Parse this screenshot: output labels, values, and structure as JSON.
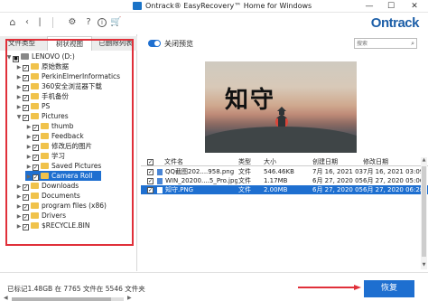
{
  "window": {
    "title": "Ontrack® EasyRecovery™ Home for Windows",
    "brand": "Ontrack",
    "minimize": "—",
    "maximize": "☐",
    "close": "✕"
  },
  "toolbar": {
    "icons": [
      "home-icon",
      "back-icon",
      "settings-icon",
      "help-icon",
      "info-icon",
      "cart-icon"
    ]
  },
  "left_tabs": [
    "文件类型",
    "树状视图",
    "已删除列表"
  ],
  "left_tabs_active": 1,
  "tree": [
    {
      "label": "LENOVO (D:)",
      "checked": "partial",
      "expanded": true,
      "depth": 0,
      "kind": "drive"
    },
    {
      "label": "原始数据",
      "checked": true,
      "expanded": false,
      "depth": 1,
      "kind": "folder"
    },
    {
      "label": "PerkinElmerInformatics",
      "checked": true,
      "expanded": false,
      "depth": 1,
      "kind": "folder"
    },
    {
      "label": "360安全浏览器下载",
      "checked": true,
      "expanded": false,
      "depth": 1,
      "kind": "folder"
    },
    {
      "label": "手机备份",
      "checked": true,
      "expanded": false,
      "depth": 1,
      "kind": "folder"
    },
    {
      "label": "PS",
      "checked": true,
      "expanded": false,
      "depth": 1,
      "kind": "folder"
    },
    {
      "label": "Pictures",
      "checked": true,
      "expanded": true,
      "depth": 1,
      "kind": "folder"
    },
    {
      "label": "thumb",
      "checked": true,
      "expanded": false,
      "depth": 2,
      "kind": "folder"
    },
    {
      "label": "Feedback",
      "checked": true,
      "expanded": false,
      "depth": 2,
      "kind": "folder"
    },
    {
      "label": "修改后的图片",
      "checked": true,
      "expanded": false,
      "depth": 2,
      "kind": "folder"
    },
    {
      "label": "学习",
      "checked": true,
      "expanded": false,
      "depth": 2,
      "kind": "folder"
    },
    {
      "label": "Saved Pictures",
      "checked": true,
      "expanded": false,
      "depth": 2,
      "kind": "folder"
    },
    {
      "label": "Camera Roll",
      "checked": true,
      "expanded": false,
      "depth": 2,
      "kind": "folder",
      "selected": true
    },
    {
      "label": "Downloads",
      "checked": true,
      "expanded": false,
      "depth": 1,
      "kind": "folder"
    },
    {
      "label": "Documents",
      "checked": true,
      "expanded": false,
      "depth": 1,
      "kind": "folder"
    },
    {
      "label": "program files (x86)",
      "checked": true,
      "expanded": false,
      "depth": 1,
      "kind": "folder"
    },
    {
      "label": "Drivers",
      "checked": true,
      "expanded": false,
      "depth": 1,
      "kind": "folder"
    },
    {
      "label": "$RECYCLE.BIN",
      "checked": true,
      "expanded": false,
      "depth": 1,
      "kind": "folder"
    }
  ],
  "preview": {
    "toggle_label": "关闭预览",
    "calligraphy": "知守"
  },
  "search": {
    "placeholder": "搜索 "
  },
  "files": {
    "columns": [
      "文件名",
      "类型",
      "大小",
      "创建日期",
      "修改日期"
    ],
    "rows": [
      {
        "name": "QQ截图202....958.png",
        "type": "文件",
        "size": "546.46KB",
        "created": "7月 16, 2021 03:...",
        "modified": "7月 16, 2021 03:09 下午",
        "checked": true,
        "selected": false
      },
      {
        "name": "WIN_20200....5_Pro.jpg",
        "type": "文件",
        "size": "1.17MB",
        "created": "6月 27, 2020 05:...",
        "modified": "6月 27, 2020 05:06 下午",
        "checked": true,
        "selected": false
      },
      {
        "name": "知守.PNG",
        "type": "文件",
        "size": "2.00MB",
        "created": "6月 27, 2020 05:...",
        "modified": "6月 27, 2020 06:28 下午",
        "checked": true,
        "selected": true
      }
    ]
  },
  "footer": {
    "status": "已标记1.48GB 在 7765 文件在 5546 文件夹",
    "recover_label": "恢复"
  },
  "colors": {
    "accent": "#1e6fd0",
    "highlight_red": "#e0303a",
    "brand_blue": "#1d5fa8"
  }
}
